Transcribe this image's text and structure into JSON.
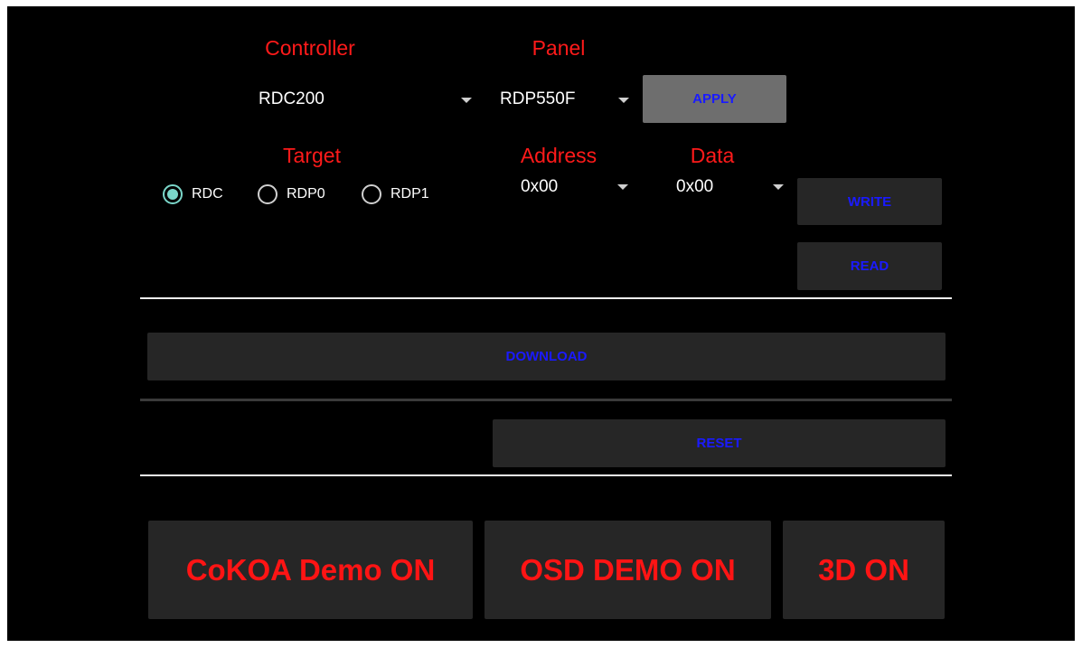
{
  "labels": {
    "controller": "Controller",
    "panel": "Panel",
    "target": "Target",
    "address": "Address",
    "data": "Data"
  },
  "spinners": {
    "controller": "RDC200",
    "panel": "RDP550F",
    "address": "0x00",
    "data": "0x00"
  },
  "target_options": [
    {
      "label": "RDC",
      "checked": true
    },
    {
      "label": "RDP0",
      "checked": false
    },
    {
      "label": "RDP1",
      "checked": false
    }
  ],
  "buttons": {
    "apply": "APPLY",
    "write": "WRITE",
    "read": "READ",
    "download": "DOWNLOAD",
    "reset": "RESET",
    "cokoa_demo": "CoKOA Demo ON",
    "osd_demo": "OSD DEMO ON",
    "three_d": "3D ON"
  },
  "colors": {
    "label_red": "#ff1a1a",
    "button_blue": "#1a1aff",
    "radio_accent": "#7ad6c9"
  }
}
